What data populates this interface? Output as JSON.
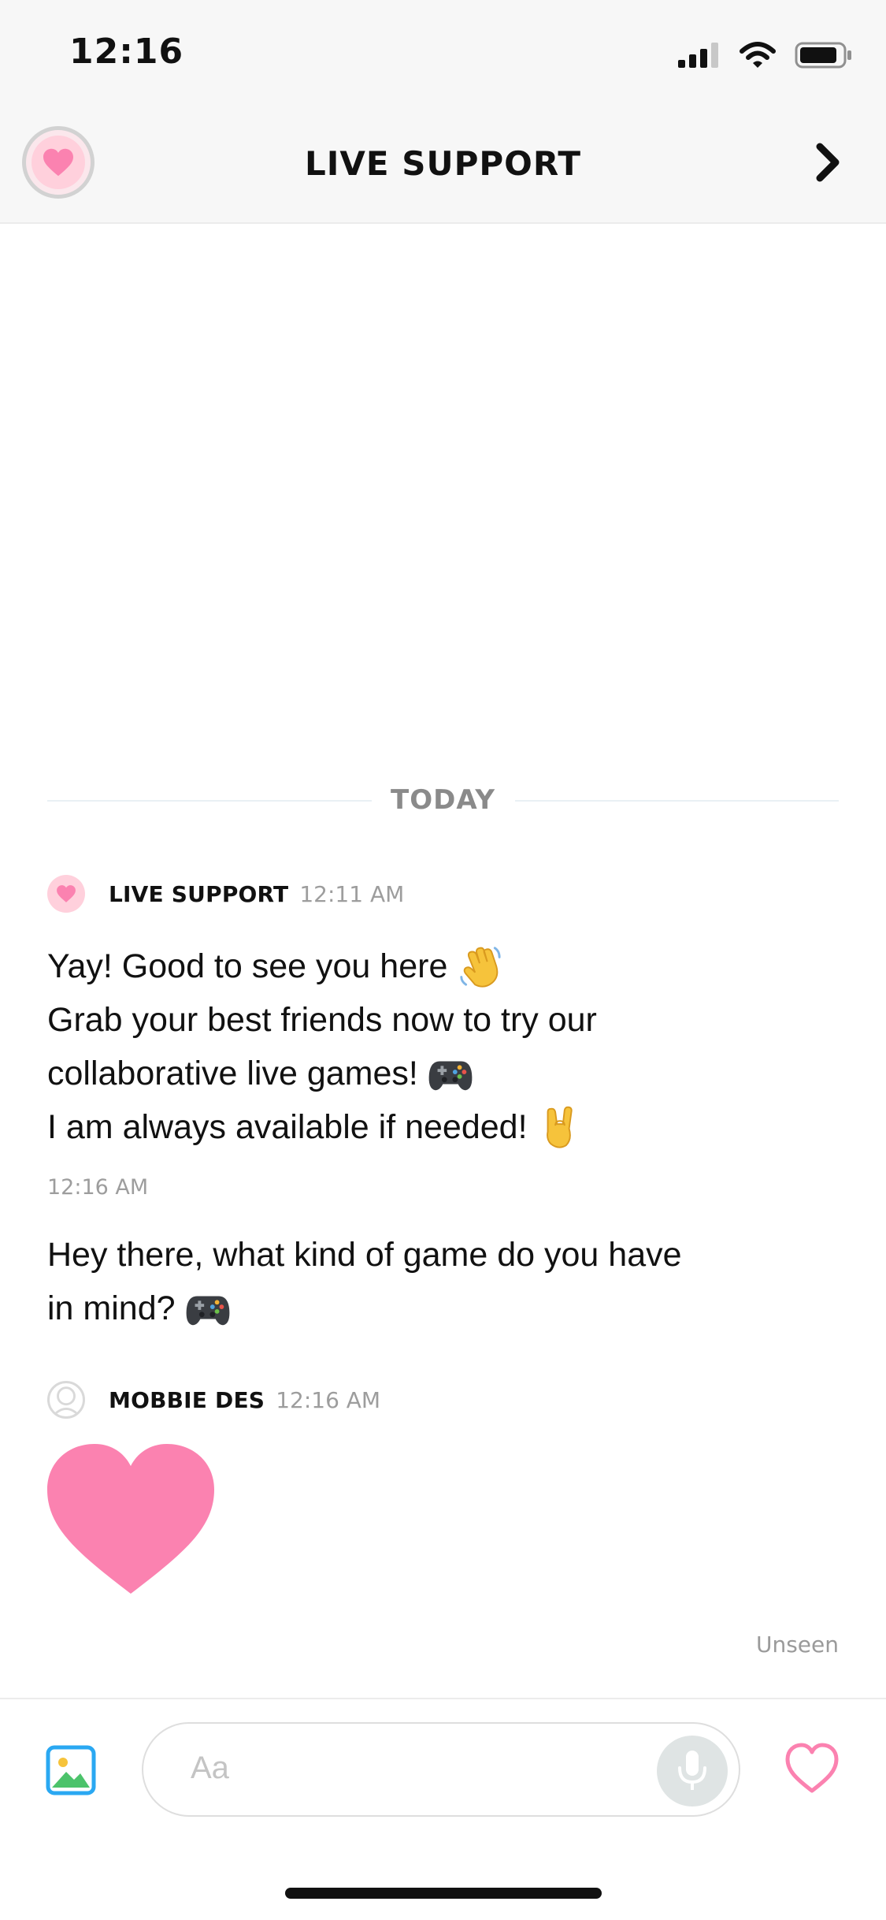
{
  "status_bar": {
    "time": "12:16"
  },
  "header": {
    "title": "LIVE SUPPORT"
  },
  "chat": {
    "divider_label": "TODAY",
    "group1": {
      "sender": "LIVE SUPPORT",
      "time": "12:11 AM",
      "message1": {
        "line1": "Yay! Good to see you here",
        "line2": "Grab your best friends now to try our",
        "line3": "collaborative live games!",
        "line4": "I am always available if needed!"
      },
      "stamp": "12:16 AM",
      "message2": {
        "line1": "Hey there, what kind of game do you have",
        "line2": "in mind?"
      }
    },
    "group2": {
      "sender": "MOBBIE DES",
      "time": "12:16 AM",
      "status": "Unseen"
    }
  },
  "composer": {
    "placeholder": "Aa"
  },
  "colors": {
    "accent_pink": "#fb82b0",
    "header_bg": "#f7f7f7",
    "muted_text": "#9d9d9d",
    "mic_bg": "#dfe4e4"
  },
  "icons": {
    "header_avatar": "heart-icon",
    "next": "chevron-right-icon",
    "photo": "image-icon",
    "mic": "microphone-icon",
    "like": "heart-outline-icon",
    "wave": "waving-hand-emoji",
    "gamepad": "gamepad-emoji",
    "rock": "rock-on-hand-emoji"
  }
}
